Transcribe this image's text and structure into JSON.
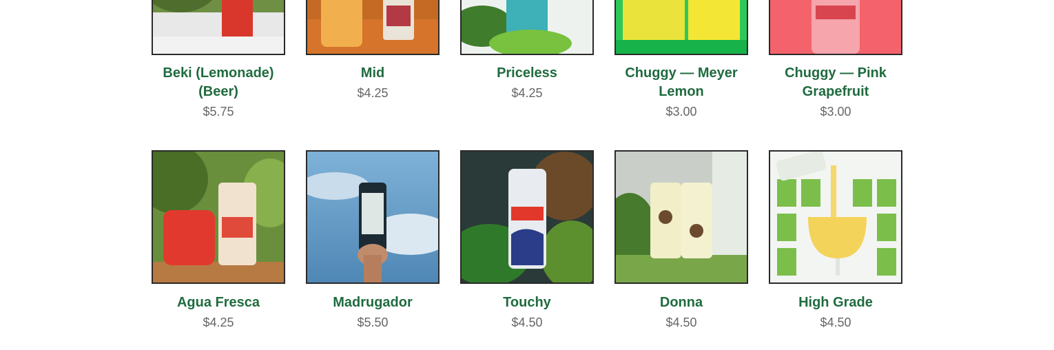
{
  "products": [
    {
      "name": "Beki (Lemonade) (Beer)",
      "price": "$5.75",
      "image": "beki-glass-photo"
    },
    {
      "name": "Mid",
      "price": "$4.25",
      "image": "mid-can-photo"
    },
    {
      "name": "Priceless",
      "price": "$4.25",
      "image": "priceless-can-photo"
    },
    {
      "name": "Chuggy — Meyer Lemon",
      "price": "$3.00",
      "image": "chuggy-meyer-lemon-photo"
    },
    {
      "name": "Chuggy — Pink Grapefruit",
      "price": "$3.00",
      "image": "chuggy-pink-grapefruit-photo"
    },
    {
      "name": "Agua Fresca",
      "price": "$4.25",
      "image": "agua-fresca-can-photo"
    },
    {
      "name": "Madrugador",
      "price": "$5.50",
      "image": "madrugador-can-photo"
    },
    {
      "name": "Touchy",
      "price": "$4.50",
      "image": "touchy-can-photo"
    },
    {
      "name": "Donna",
      "price": "$4.50",
      "image": "donna-can-photo"
    },
    {
      "name": "High Grade",
      "price": "$4.50",
      "image": "high-grade-pour-photo"
    }
  ],
  "colors": {
    "name": "#1f6b3f",
    "price": "#666666",
    "border": "#2a2a2a"
  }
}
